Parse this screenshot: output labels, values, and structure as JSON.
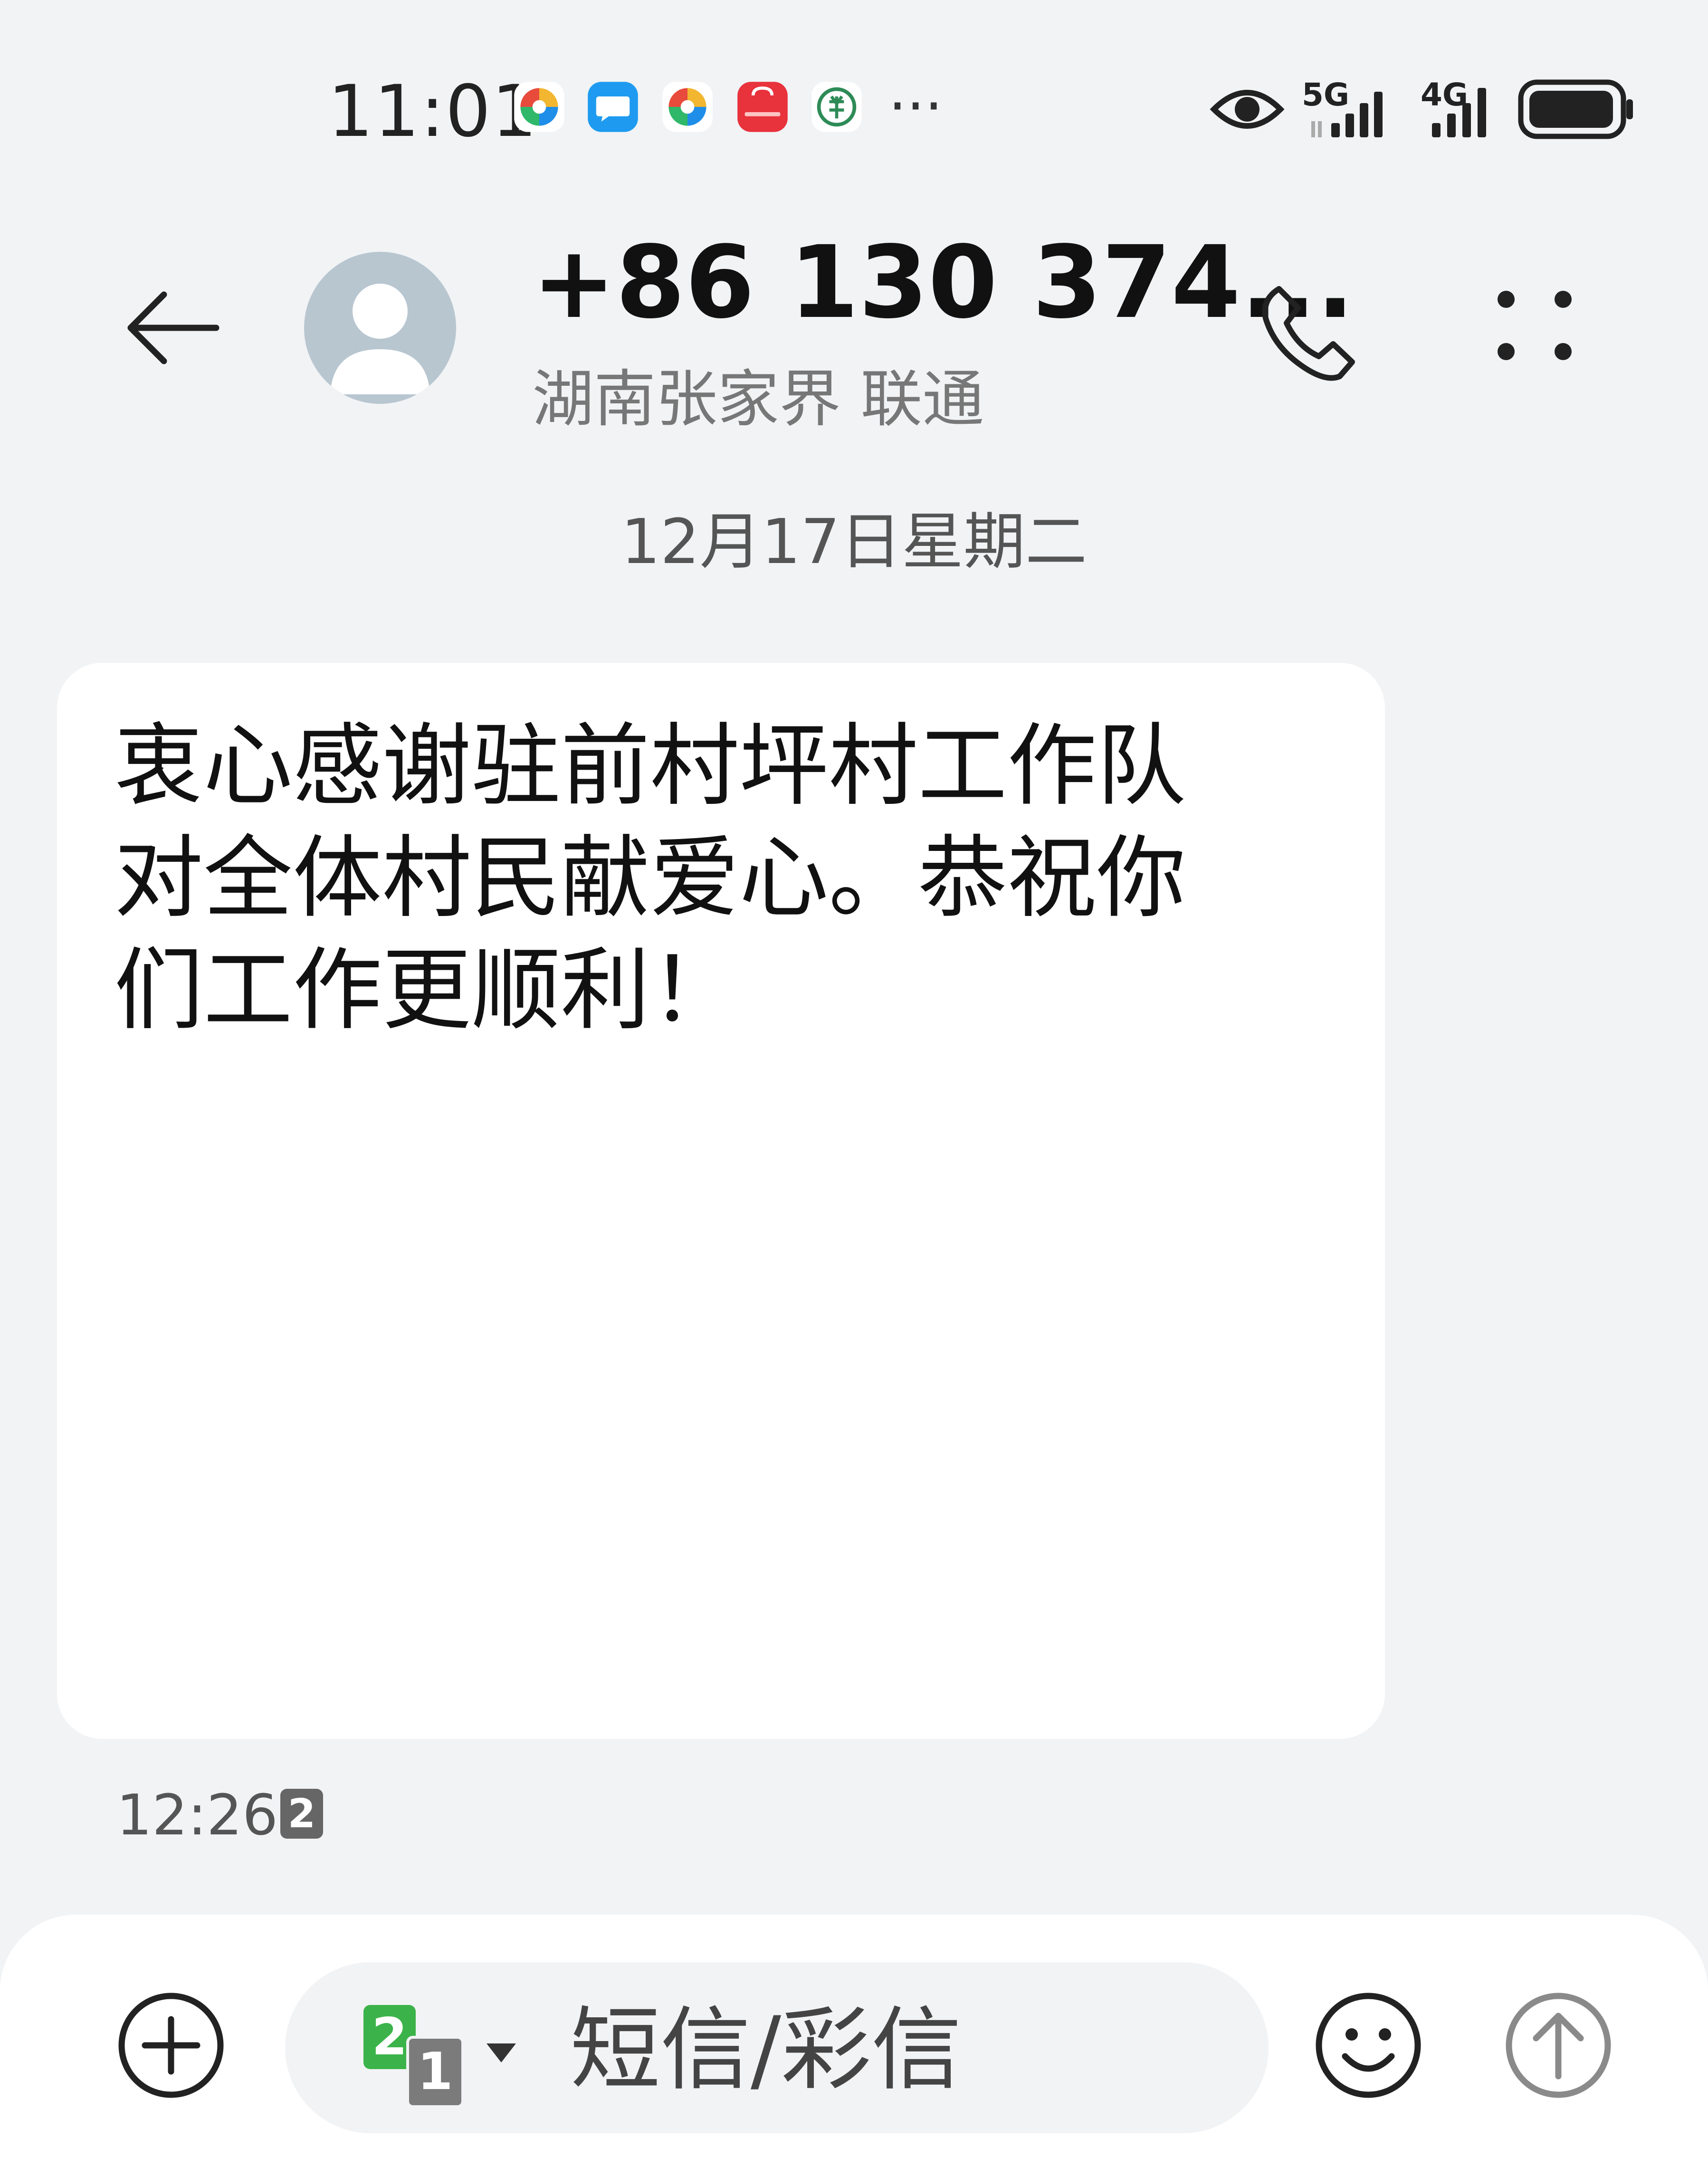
{
  "status_bar": {
    "time": "11:01",
    "notification_icons": [
      {
        "icon": "pinwheel-app-icon",
        "color": "#e84a3c"
      },
      {
        "icon": "message-app-icon",
        "color": "#1e9bf0"
      },
      {
        "icon": "pinwheel-app-icon",
        "color": "#e84a3c"
      },
      {
        "icon": "huawei-appgallery-icon",
        "color": "#e8323c"
      },
      {
        "icon": "bank-app-icon",
        "color": "#2e8b57"
      }
    ],
    "more": "···",
    "network_1": "5G",
    "network_2": "4G",
    "eye_comfort": "eye-icon",
    "battery_icon": "battery-icon"
  },
  "header": {
    "back_icon": "arrow-left-icon",
    "avatar_icon": "person-avatar-icon",
    "number": "+86 130 374...",
    "location": "湖南张家界 联通",
    "call_icon": "phone-icon",
    "more_icon": "more-dots-icon"
  },
  "conversation": {
    "date": "12月17日星期二",
    "messages": [
      {
        "text": "衷心感谢驻前村坪村工作队对全体村民献爱心。恭祝你们工作更顺利！",
        "time": "12:26",
        "sim": "2"
      }
    ]
  },
  "compose": {
    "add_icon": "plus-circle-icon",
    "sim_primary": "2",
    "sim_secondary": "1",
    "placeholder": "短信/彩信",
    "emoji_icon": "smiley-icon",
    "send_icon": "send-arrow-icon"
  },
  "colors": {
    "background": "#f1f3f5",
    "bubble": "#ffffff",
    "sim_active": "#3bb34a",
    "sim_inactive": "#7b7b7b",
    "avatar": "#b8c6d0"
  }
}
